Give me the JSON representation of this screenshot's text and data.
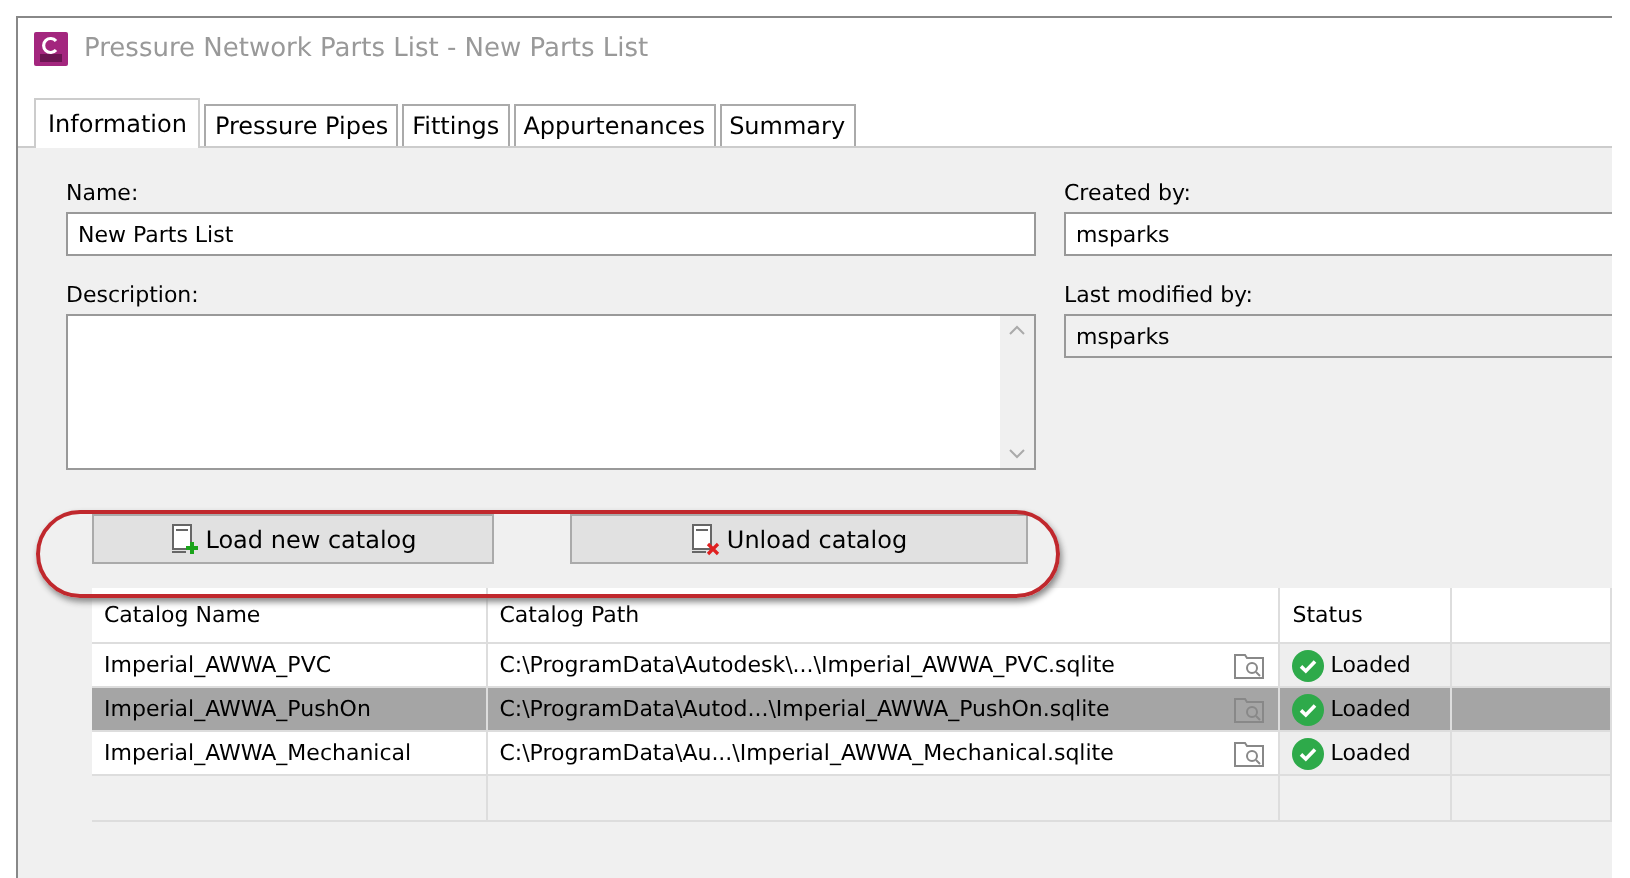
{
  "window": {
    "title": "Pressure Network Parts List - New Parts List"
  },
  "tabs": [
    {
      "label": "Information",
      "selected": true
    },
    {
      "label": "Pressure Pipes",
      "selected": false
    },
    {
      "label": "Fittings",
      "selected": false
    },
    {
      "label": "Appurtenances",
      "selected": false
    },
    {
      "label": "Summary",
      "selected": false
    }
  ],
  "name": {
    "label": "Name:",
    "value": "New Parts List"
  },
  "description": {
    "label": "Description:"
  },
  "created_by": {
    "label": "Created by:",
    "value": "msparks"
  },
  "last_modified_by": {
    "label": "Last modified by:",
    "value": "msparks"
  },
  "buttons": [
    {
      "label": "Load new catalog",
      "kind": "load"
    },
    {
      "label": "Unload catalog",
      "kind": "unload"
    }
  ],
  "table": {
    "columns": [
      "Catalog Name",
      "Catalog Path",
      "Status"
    ],
    "rows": [
      {
        "name": "Imperial_AWWA_PVC",
        "path": "C:\\ProgramData\\Autodesk\\...\\Imperial_AWWA_PVC.sqlite",
        "status": "Loaded",
        "selected": false
      },
      {
        "name": "Imperial_AWWA_PushOn",
        "path": "C:\\ProgramData\\Autod...\\Imperial_AWWA_PushOn.sqlite",
        "status": "Loaded",
        "selected": true
      },
      {
        "name": "Imperial_AWWA_Mechanical",
        "path": "C:\\ProgramData\\Au...\\Imperial_AWWA_Mechanical.sqlite",
        "status": "Loaded",
        "selected": false
      }
    ]
  }
}
